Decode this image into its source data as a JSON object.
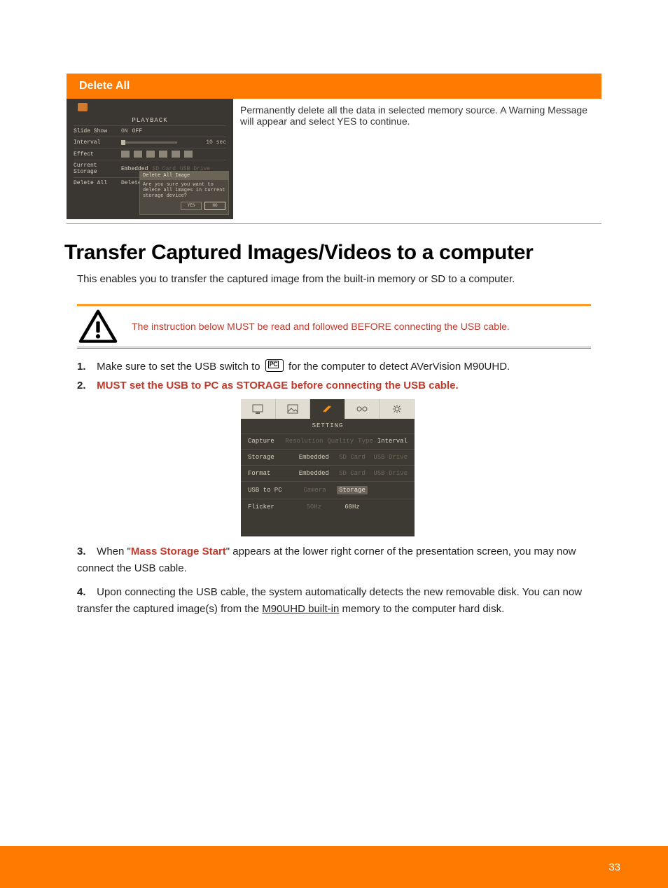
{
  "colors": {
    "accent": "#ff7a00",
    "danger": "#c0392b"
  },
  "orange_band_label": "Delete All",
  "playback": {
    "header": "PLAYBACK",
    "rows": {
      "slide_show": {
        "label": "Slide Show",
        "on": "ON",
        "off": "OFF"
      },
      "interval": {
        "label": "Interval",
        "right": "10 sec"
      },
      "effect": {
        "label": "Effect"
      },
      "storage": {
        "label": "Current Storage",
        "opt1": "Embedded",
        "opt2": "SD Card",
        "opt3": "USB Drive"
      },
      "delete_all": {
        "label": "Delete All",
        "button": "Delete"
      }
    },
    "dialog": {
      "title": "Delete All Image",
      "body": "Are you sure you want to delete all images in current storage device?",
      "yes": "YES",
      "no": "NO"
    }
  },
  "row_desc": "Permanently delete all the data in selected memory source. A Warning Message will appear and select YES to continue.",
  "big_heading": "Transfer Captured Images/Videos to a computer",
  "intro": "This enables you to transfer the captured image from the built-in memory or SD to a computer.",
  "warn_text": "The instruction below MUST be read and followed BEFORE connecting the USB cable.",
  "steps": {
    "s1_a": "1.",
    "s1_b": "Make sure to set the USB switch to",
    "s1_c": "for the computer to detect AVerVision M90UHD.",
    "s2_a": "2.",
    "s2": "MUST set the USB to PC as STORAGE before connecting the USB cable.",
    "s3_a": "3.",
    "s3_b": "When \"",
    "s3_hl": "Mass Storage Start",
    "s3_c": "\" appears at the lower right corner of the presentation screen, you may now connect the USB cable.",
    "s4_a": "4.",
    "s4_b": "Upon connecting the USB cable, the system automatically detects the new removable disk. You can now transfer the captured image(s) from the ",
    "s4_u": "M90UHD built-in",
    "s4_c": " memory to the computer hard disk."
  },
  "setting": {
    "header": "SETTING",
    "rows": {
      "capture": {
        "label": "Capture",
        "o1": "Resolution",
        "o2": "Quality",
        "o3": "Type",
        "o4": "Interval"
      },
      "storage": {
        "label": "Storage",
        "o1": "Embedded",
        "o2": "SD Card",
        "o3": "USB Drive"
      },
      "format": {
        "label": "Format",
        "o1": "Embedded",
        "o2": "SD Card",
        "o3": "USB Drive"
      },
      "usbpc": {
        "label": "USB to PC",
        "o1": "Camera",
        "sel": "Storage"
      },
      "flicker": {
        "label": "Flicker",
        "o1": "50Hz",
        "o2": "60Hz"
      }
    },
    "tab_icons": [
      "pc-ab-icon",
      "image-icon",
      "tools-icon",
      "link-icon",
      "gear-icon"
    ]
  },
  "footer": "33"
}
